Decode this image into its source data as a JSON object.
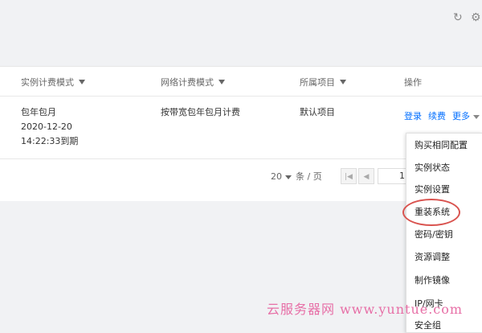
{
  "toolbar": {
    "refresh_icon": "refresh-icon",
    "settings_icon": "gear-icon"
  },
  "table": {
    "headers": [
      "实例计费模式",
      "网络计费模式",
      "所属项目",
      "操作"
    ],
    "row": {
      "billing_mode": "包年包月",
      "expire_date": "2020-12-20",
      "expire_time": "14:22:33到期",
      "network_billing": "按带宽包年包月计费",
      "project": "默认项目",
      "actions": {
        "login": "登录",
        "renew": "续费",
        "more": "更多"
      }
    }
  },
  "pagination": {
    "page_size": "20",
    "unit": "条 / 页",
    "current_page": "1"
  },
  "more_menu": {
    "items": [
      "购买相同配置",
      "实例状态",
      "实例设置",
      "重装系统",
      "密码/密钥",
      "资源调整",
      "制作镜像",
      "IP/网卡",
      "安全组"
    ],
    "highlighted": "重装系统",
    "highlight_color": "#d9534f"
  },
  "watermark": "云服务器网 www.yuntue.com"
}
